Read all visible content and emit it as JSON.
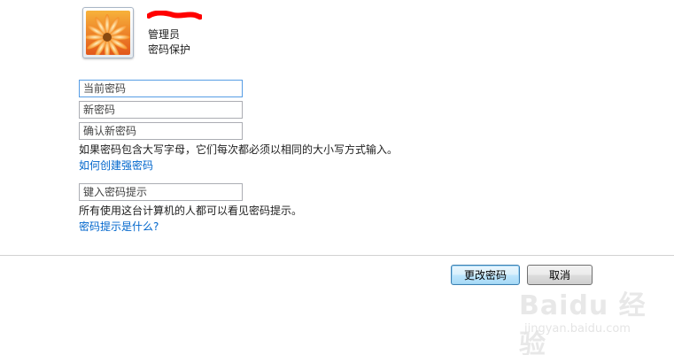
{
  "user": {
    "name": "",
    "role": "管理员",
    "status": "密码保护"
  },
  "fields": {
    "current_password_placeholder": "当前密码",
    "new_password_placeholder": "新密码",
    "confirm_password_placeholder": "确认新密码",
    "hint_placeholder": "键入密码提示"
  },
  "texts": {
    "case_notice": "如果密码包含大写字母，它们每次都必须以相同的大小写方式输入。",
    "strong_password_link": "如何创建强密码",
    "hint_notice": "所有使用这台计算机的人都可以看见密码提示。",
    "hint_link": "密码提示是什么?"
  },
  "buttons": {
    "change_password": "更改密码",
    "cancel": "取消"
  },
  "watermark": {
    "brand": "Baidu 经验",
    "url": "jingyan.baidu.com"
  },
  "colors": {
    "link": "#0066cc",
    "redaction": "#ff0000",
    "focus_border": "#569de5"
  }
}
